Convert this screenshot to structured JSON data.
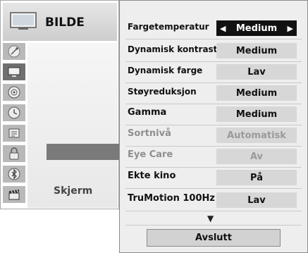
{
  "menu": {
    "title": "BILDE",
    "current_item_label": "Skjerm"
  },
  "sidebar": {
    "items": [
      {
        "icon": "satellite-dish-icon",
        "active": false
      },
      {
        "icon": "tv-screen-icon",
        "active": true
      },
      {
        "icon": "speaker-icon",
        "active": false
      },
      {
        "icon": "clock-icon",
        "active": false
      },
      {
        "icon": "settings-box-icon",
        "active": false
      },
      {
        "icon": "lock-icon",
        "active": false
      },
      {
        "icon": "bluetooth-icon",
        "active": false
      },
      {
        "icon": "clapperboard-icon",
        "active": false
      }
    ]
  },
  "submenu": {
    "rows": [
      {
        "label": "Fargetemperatur",
        "value": "Medium",
        "left_arrow": "◀",
        "right_arrow": "▶"
      },
      {
        "label": "Dynamisk kontrast",
        "value": "Medium"
      },
      {
        "label": "Dynamisk farge",
        "value": "Lav"
      },
      {
        "label": "Støyreduksjon",
        "value": "Medium"
      },
      {
        "label": "Gamma",
        "value": "Medium"
      },
      {
        "label": "Sortnivå",
        "value": "Automatisk"
      },
      {
        "label": "Eye Care",
        "value": "Av"
      },
      {
        "label": "Ekte kino",
        "value": "På"
      },
      {
        "label": "TruMotion 100Hz",
        "value": "Lav"
      }
    ],
    "scroll_indicator": "▼",
    "exit_label": "Avslutt"
  },
  "colors": {
    "selected_bg": "#111111",
    "highlight": "#7a7a7a",
    "disabled_text": "#8f8f8f"
  }
}
